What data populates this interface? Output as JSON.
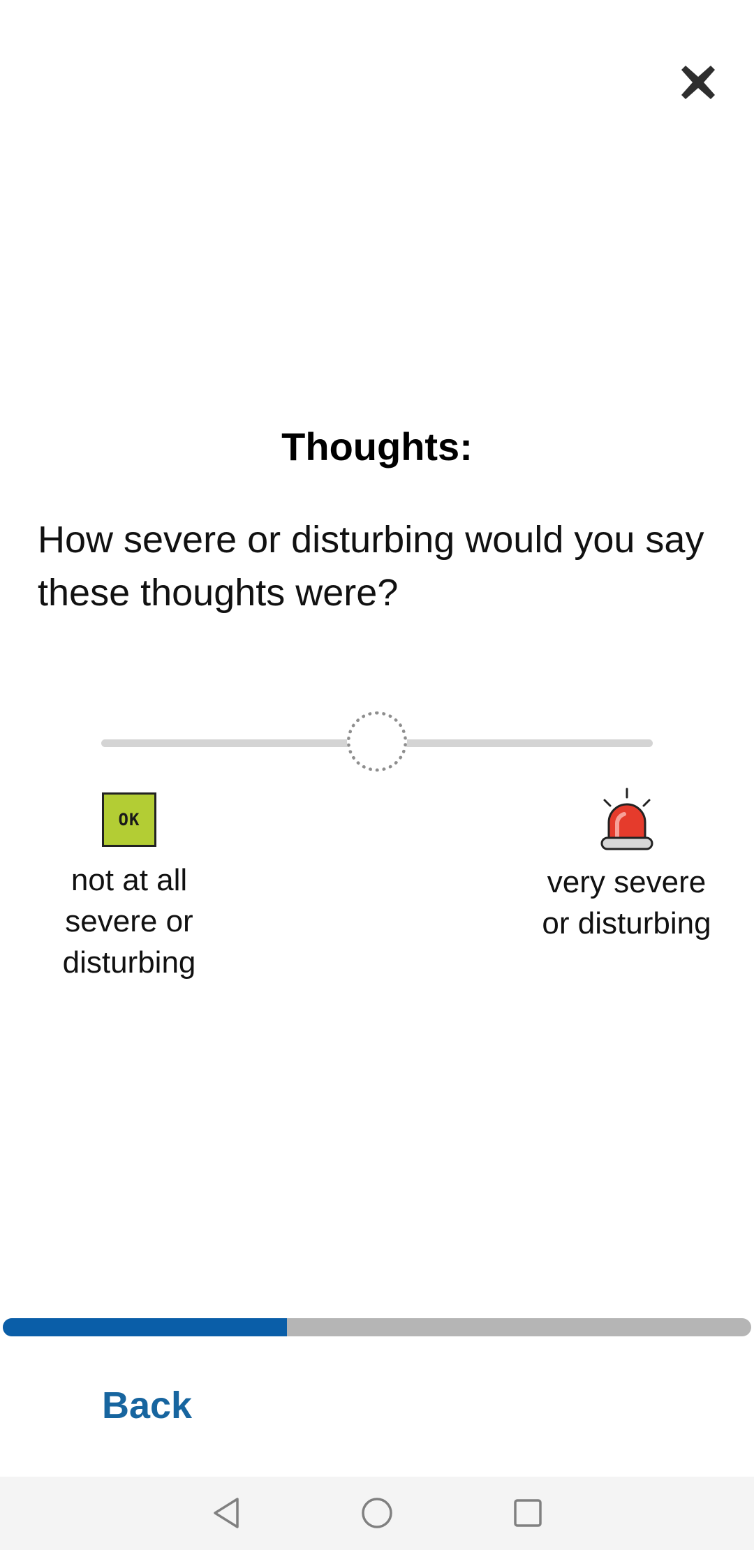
{
  "icons": {
    "close": "close-icon",
    "ok": "ok-icon",
    "siren": "siren-icon",
    "nav_back": "triangle-back-icon",
    "nav_home": "circle-home-icon",
    "nav_recents": "square-recents-icon"
  },
  "colors": {
    "accent": "#0a5ea8",
    "back_link": "#17659f",
    "ok_badge": "#b3cd34",
    "siren_red": "#e53b2c",
    "progress_track": "#b5b5b5",
    "slider_track": "#d4d4d4"
  },
  "header": {
    "title": "Thoughts:"
  },
  "question": {
    "text": "How severe or disturbing would you say these thoughts were?"
  },
  "slider": {
    "value_percent": 50
  },
  "anchors": {
    "left": {
      "badge_text": "OK",
      "line1": "not at all",
      "line2": "severe or",
      "line3": "disturbing"
    },
    "right": {
      "line1": "very severe",
      "line2": "or disturbing"
    }
  },
  "progress": {
    "fraction": 0.38
  },
  "footer": {
    "back_label": "Back"
  }
}
